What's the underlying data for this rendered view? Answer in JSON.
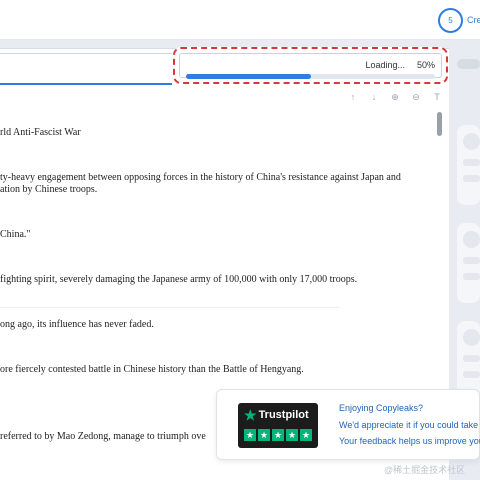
{
  "header": {
    "credits_count": "5",
    "credits_label": "Cre"
  },
  "loading": {
    "text": "Loading...",
    "percent_label": "50%",
    "progress": 0.5
  },
  "toolbar": {
    "icons": [
      "arrow-up-icon",
      "arrow-down-icon",
      "zoom-in-icon",
      "zoom-out-icon",
      "text-size-icon"
    ],
    "glyphs": [
      "↑",
      "↓",
      "⊕",
      "⊖",
      "T"
    ]
  },
  "document": {
    "lines": [
      "rld Anti-Fascist War",
      "ty-heavy engagement between opposing forces in the history of China's resistance against Japan and",
      "ation by Chinese troops.",
      " China.\"",
      "fighting spirit, severely damaging the Japanese army of 100,000 with only 17,000 troops.",
      "ong ago, its influence has never faded.",
      "ore fiercely contested battle in Chinese history than the Battle of Hengyang.",
      "referred to by Mao Zedong, manage to triumph ove"
    ]
  },
  "toast": {
    "brand": "Trustpilot",
    "title": "Enjoying Copyleaks?",
    "line2": "We'd appreciate it if you could take a",
    "line3": "Your feedback helps us improve you"
  },
  "watermark": "@稀土掘金技术社区",
  "colors": {
    "accent": "#2f7de1",
    "trustpilot_green": "#00b67a",
    "highlight_border": "#d33a3a"
  }
}
